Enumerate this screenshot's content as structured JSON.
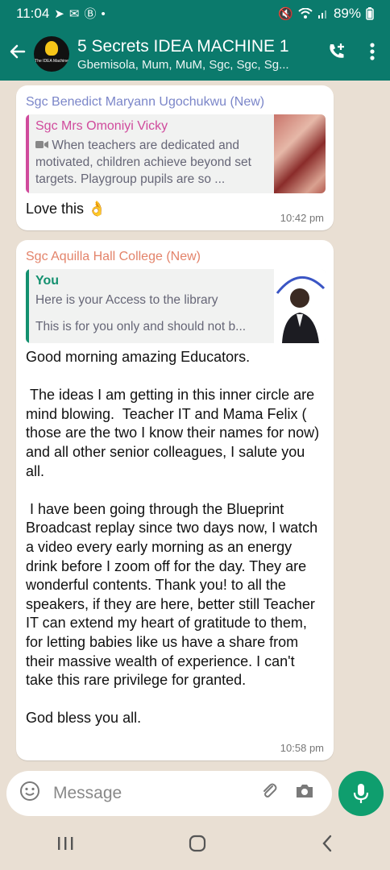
{
  "status": {
    "time": "11:04",
    "left_icons": [
      "send-icon",
      "mail-icon",
      "b-icon",
      "dot-icon"
    ],
    "battery": "89%"
  },
  "header": {
    "back_icon": "arrow-left-icon",
    "avatar_text": "The IDEA Machine",
    "title": "5 Secrets IDEA MACHINE 1",
    "subtitle": "Gbemisola, Mum, MuM, Sgc, Sgc, Sg...",
    "add_call_icon": "phone-plus-icon",
    "menu_icon": "more-vert-icon"
  },
  "messages": [
    {
      "sender": "Sgc Benedict Maryann Ugochukwu (New)",
      "sender_color": "#7b86c9",
      "quote": {
        "name": "Sgc Mrs Omoniyi Vicky",
        "name_color": "#d04a9c",
        "bar_color": "#d04a9c",
        "media_icon": "video-icon",
        "text": "When teachers are dedicated and motivated, children achieve beyond set targets. Playgroup pupils are so ..."
      },
      "text": "Love this 👌",
      "time": "10:42 pm"
    },
    {
      "sender": "Sgc Aquilla Hall College (New)",
      "sender_color": "#e3836a",
      "quote": {
        "name": "You",
        "name_color": "#13906f",
        "bar_color": "#13906f",
        "line1": "Here is your Access to the library",
        "line2": "This is for you only and should not b..."
      },
      "text": "Good morning amazing Educators.\n\n The ideas I am getting in this inner circle are mind blowing.  Teacher IT and Mama Felix ( those are the two I know their names for now) and all other senior colleagues, I salute you all.\n\n I have been going through the Blueprint Broadcast replay since two days now, I watch a video every early morning as an energy drink before I zoom off for the day. They are wonderful contents. Thank you! to all the speakers, if they are here, better still Teacher IT can extend my heart of gratitude to them, for letting babies like us have a share from their massive wealth of experience. I can't take this rare privilege for granted.\n\nGod bless you all.",
      "time": "10:58 pm"
    }
  ],
  "input": {
    "placeholder": "Message",
    "emoji_icon": "emoji-icon",
    "attach_icon": "paperclip-icon",
    "camera_icon": "camera-icon",
    "mic_icon": "mic-icon"
  },
  "nav": {
    "recents_icon": "recents-icon",
    "home_icon": "home-icon",
    "back_icon": "nav-back-icon"
  }
}
